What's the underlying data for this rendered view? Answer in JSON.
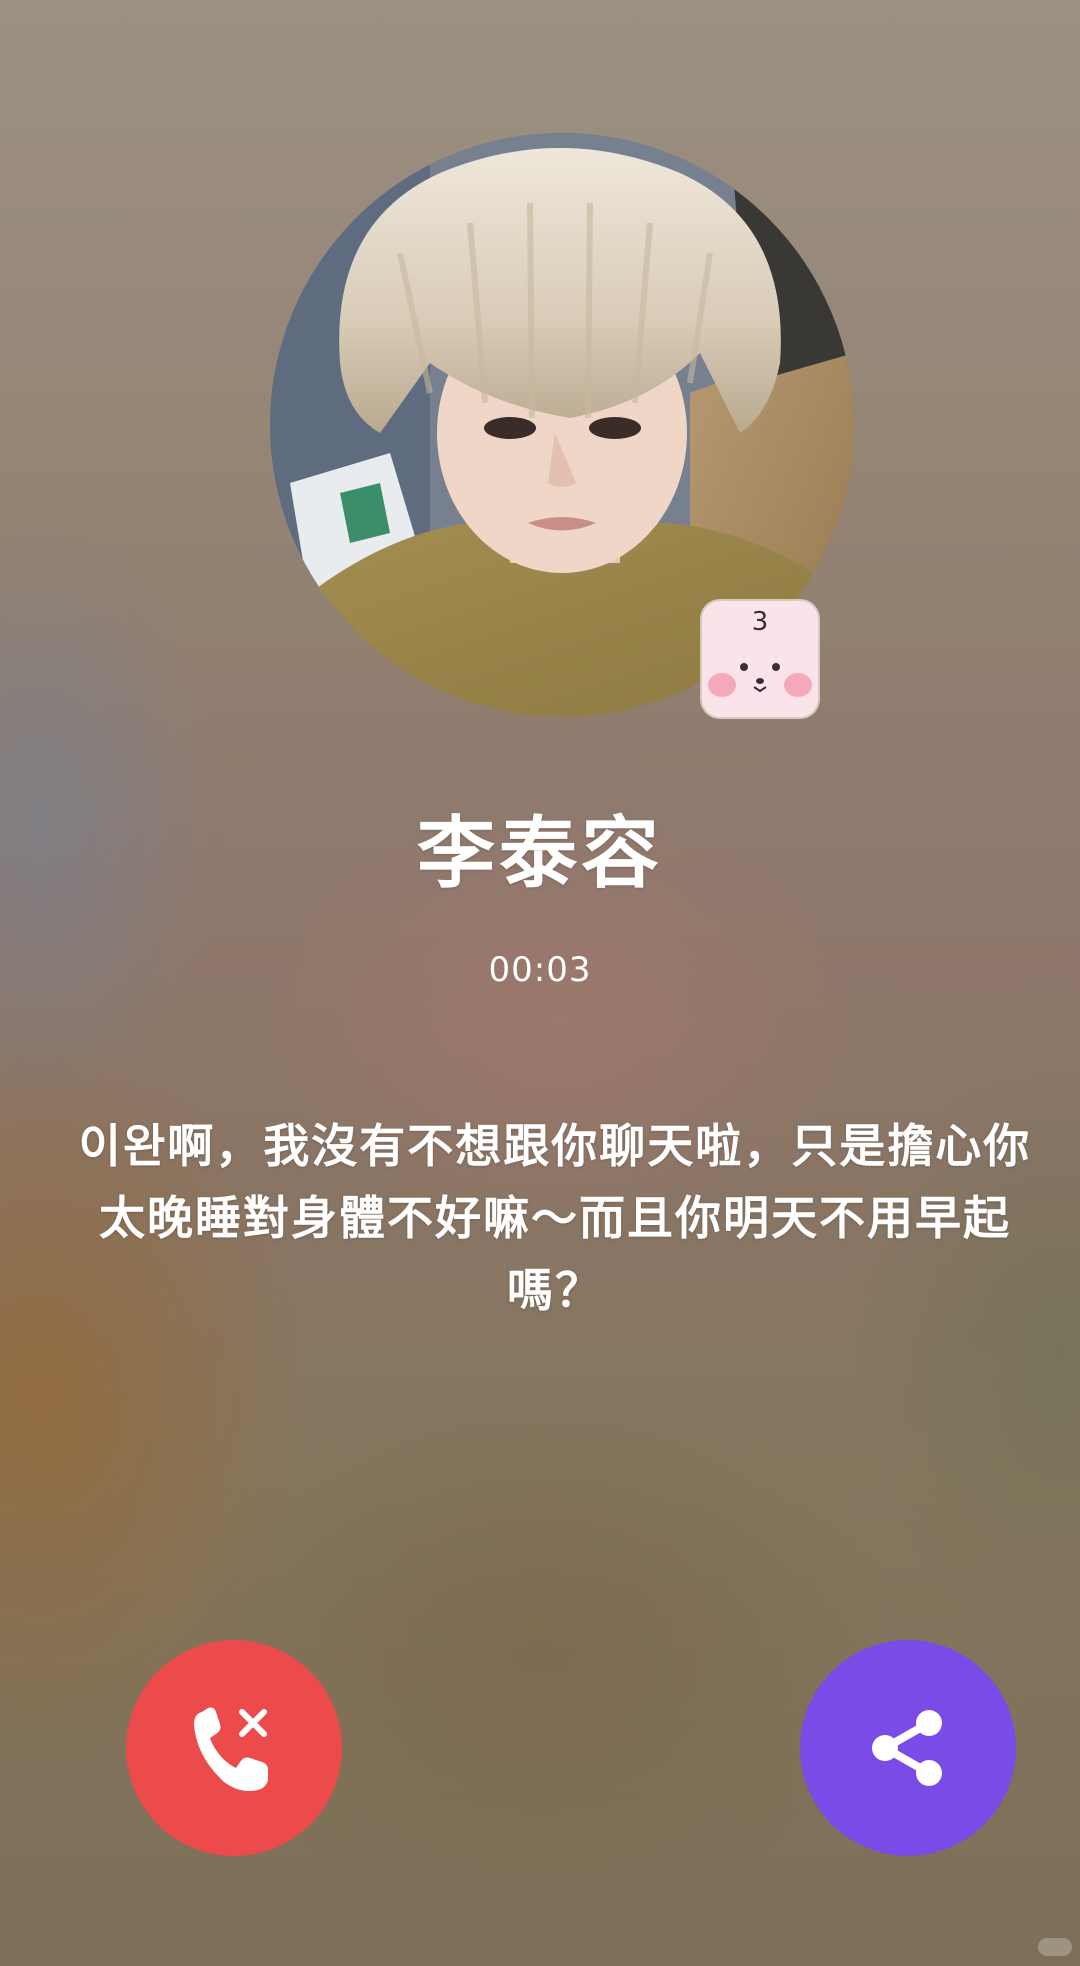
{
  "call": {
    "contact_name": "李泰容",
    "duration": "00:03",
    "caption": "이완啊，我沒有不想跟你聊天啦，只是擔心你太晚睡對身體不好嘛～而且你明天不用早起嗎？"
  },
  "avatar": {
    "sticker_number": "3"
  },
  "buttons": {
    "end_call_icon": "phone-x-icon",
    "share_icon": "share-icon"
  },
  "colors": {
    "end_call": "#ec4a4b",
    "share": "#7b4be7",
    "text": "#ffffff"
  }
}
